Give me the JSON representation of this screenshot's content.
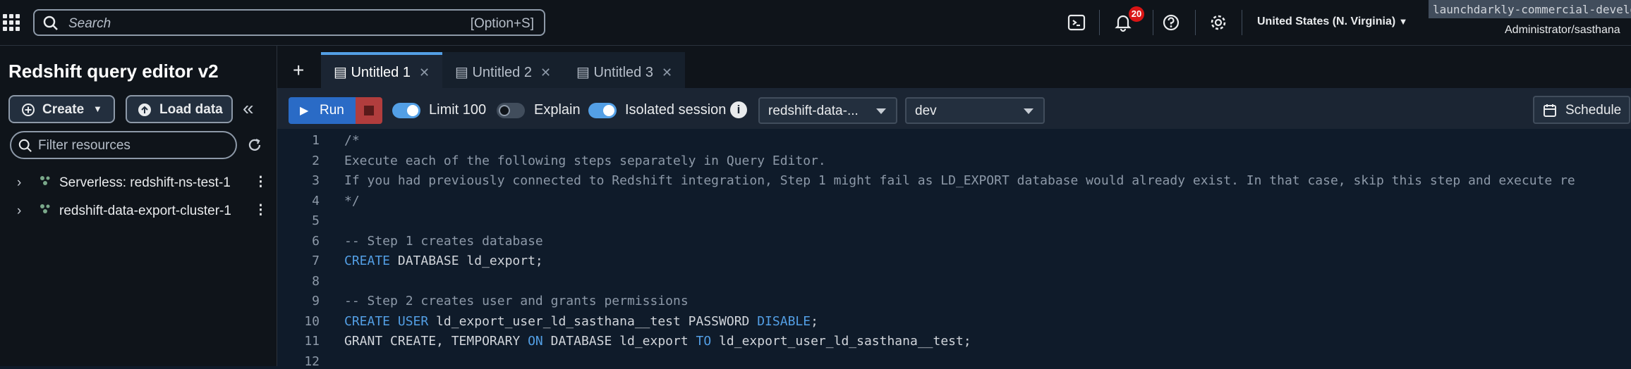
{
  "topbar": {
    "search_placeholder": "Search",
    "search_shortcut": "[Option+S]",
    "notifications_count": "20",
    "region": "United States (N. Virginia)",
    "account": "launchdarkly-commercial-developme",
    "role": "Administrator/sasthana"
  },
  "sidebar": {
    "title": "Redshift query editor v2",
    "create_label": "Create",
    "load_label": "Load data",
    "filter_placeholder": "Filter resources",
    "items": [
      {
        "label": "Serverless: redshift-ns-test-1"
      },
      {
        "label": "redshift-data-export-cluster-1"
      }
    ]
  },
  "tabs": [
    {
      "label": "Untitled 1"
    },
    {
      "label": "Untitled 2"
    },
    {
      "label": "Untitled 3"
    }
  ],
  "toolbar": {
    "run_label": "Run",
    "limit_label": "Limit 100",
    "explain_label": "Explain",
    "isolated_label": "Isolated session",
    "connection_value": "redshift-data-...",
    "database_value": "dev",
    "schedule_label": "Schedule"
  },
  "editor": {
    "line_numbers": [
      "1",
      "2",
      "3",
      "4",
      "5",
      "6",
      "7",
      "8",
      "9",
      "10",
      "11",
      "12"
    ],
    "lines": [
      "/*",
      "Execute each of the following steps separately in Query Editor.",
      "If you had previously connected to Redshift integration, Step 1 might fail as LD_EXPORT database would already exist. In that case, skip this step and execute re",
      "*/",
      "",
      "-- Step 1 creates database",
      "",
      "",
      "-- Step 2 creates user and grants permissions",
      "",
      "",
      ""
    ],
    "l7": {
      "kw": "CREATE",
      "rest": " DATABASE ld_export;"
    },
    "l10": {
      "kw1": "CREATE USER",
      "mid": " ld_export_user_ld_sasthana__test PASSWORD ",
      "kw2": "DISABLE",
      "end": ";"
    },
    "l11": {
      "p1": "GRANT CREATE, TEMPORARY ",
      "kw1": "ON",
      "p2": " DATABASE ld_export ",
      "kw2": "TO",
      "p3": " ld_export_user_ld_sasthana__test;"
    }
  }
}
